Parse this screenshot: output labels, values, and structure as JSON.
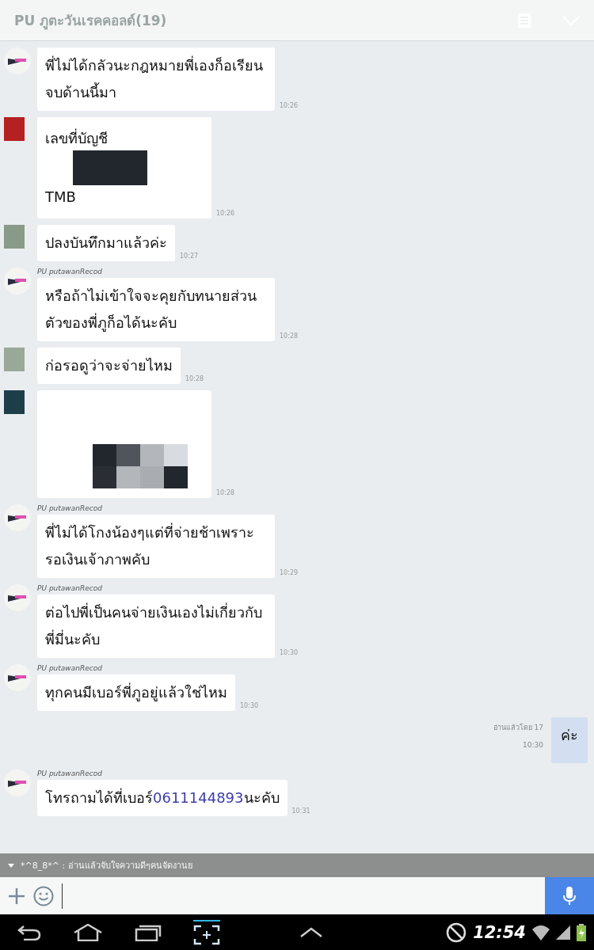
{
  "header": {
    "title": "PU ภูตะวันเรคคอลด์(19)"
  },
  "messages": [
    {
      "kind": "incoming",
      "text": "พี่ไม่ได้กลัวนะกฎหมายพี่เองก็อเรียนจบด้านนี้มา",
      "time": "10:26"
    },
    {
      "kind": "redacted",
      "color": "#b52020",
      "lines": [
        "เลขที่บัญชี",
        "TMB"
      ],
      "time": "10:26"
    },
    {
      "kind": "incoming",
      "color": "#8a9a88",
      "text": "ปลงบันทึกมาแล้วค่ะ",
      "time": "10:27"
    },
    {
      "kind": "incoming",
      "sender": "PU putawanRecod",
      "text": "หรือถ้าไม่เข้าใจจะคุยกับทนายส่วนตัวของพี่ภูก็อได้นะคับ",
      "time": "10:28"
    },
    {
      "kind": "incoming",
      "color": "#9aa898",
      "text": "ก่อรอดูว่าจะจ่ายไหม",
      "time": "10:28"
    },
    {
      "kind": "redacted",
      "color": "#1d3d48",
      "time": "10:28"
    },
    {
      "kind": "incoming",
      "sender": "PU putawanRecod",
      "text": "พี่ไม่ได้โกงน้องๆแต่ที่จ่ายช้าเพราะรอเงินเจ้าภาพคับ",
      "time": "10:29"
    },
    {
      "kind": "incoming",
      "sender": "PU putawanRecod",
      "text": "ต่อไปพี่เป็นคนจ่ายเงินเองไม่เกี่ยวกับพี่มี่นะคับ",
      "time": "10:30"
    },
    {
      "kind": "incoming",
      "sender": "PU putawanRecod",
      "text": "ทุกคนมีเบอร์พี่ภูอยู่แล้วใช่ไหม",
      "time": "10:30"
    },
    {
      "kind": "outgoing",
      "read": "อ่านแล้วโดย 17",
      "text": "ค่ะ",
      "time": "10:30"
    },
    {
      "kind": "incoming",
      "sender": "PU putawanRecod",
      "text": "โทรถามได้ที่เบอร์",
      "link": "0611144893",
      "after": "นะคับ",
      "time": "10:31"
    }
  ],
  "ticker": {
    "text": "*^8_8*^ : อ่านแล้วจับใจความดีๆคนจัดงานย"
  },
  "status": {
    "time": "12:54"
  }
}
